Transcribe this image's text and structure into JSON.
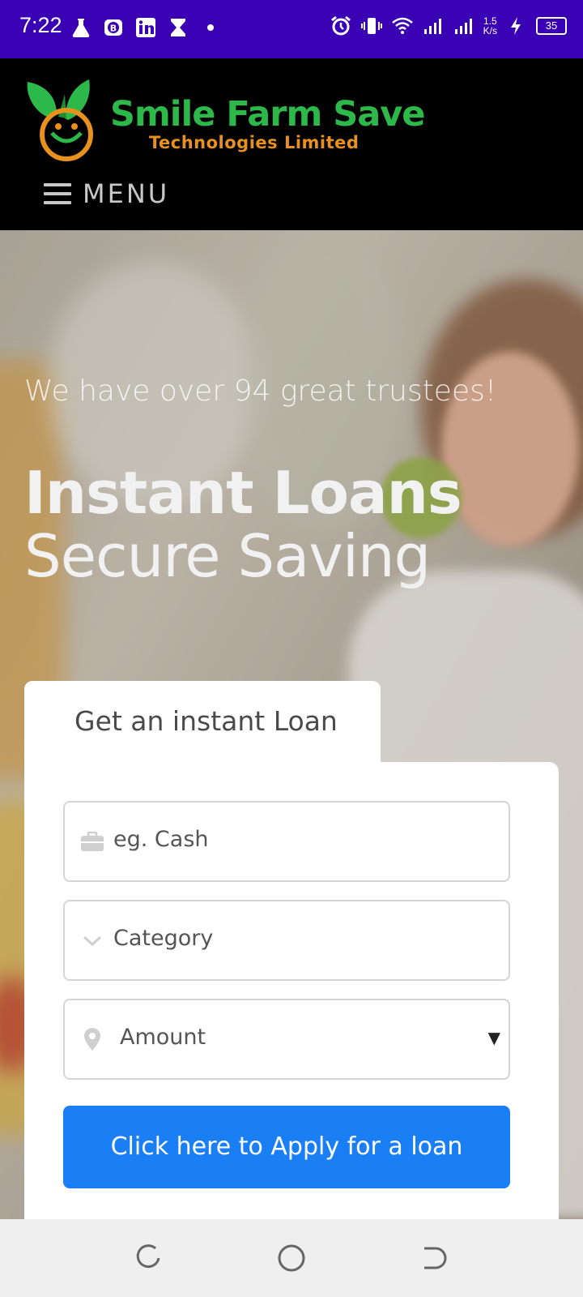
{
  "status_bar": {
    "time": "7:22",
    "left_icons": [
      "flask-icon",
      "b-badge-icon",
      "linkedin-icon",
      "hourglass-icon",
      "dot-icon"
    ],
    "right_icons": [
      "alarm-icon",
      "vibrate-icon",
      "wifi-icon",
      "signal-icon",
      "signal-icon",
      "charging-icon"
    ],
    "network_speed_value": "1.5",
    "network_speed_unit": "K/s",
    "battery_level": "35"
  },
  "header": {
    "brand_name": "Smile Farm Save",
    "brand_subtitle": "Technologies Limited",
    "menu_label": "MENU",
    "colors": {
      "brand_green": "#2db84a",
      "brand_orange": "#e8911c"
    }
  },
  "hero": {
    "trustees_text": "We have over 94 great trustees!",
    "headline_bold": "Instant Loans",
    "headline_light": "Secure Saving"
  },
  "loan_form": {
    "tab_label": "Get an instant Loan",
    "loan_type_placeholder": "eg. Cash",
    "category_placeholder": "Category",
    "amount_placeholder": "Amount",
    "apply_button_label": "Click here to Apply for a loan",
    "colors": {
      "button": "#1a7ff5"
    }
  },
  "nav_bar": {
    "buttons": [
      "recents-icon",
      "home-icon",
      "back-icon"
    ]
  }
}
